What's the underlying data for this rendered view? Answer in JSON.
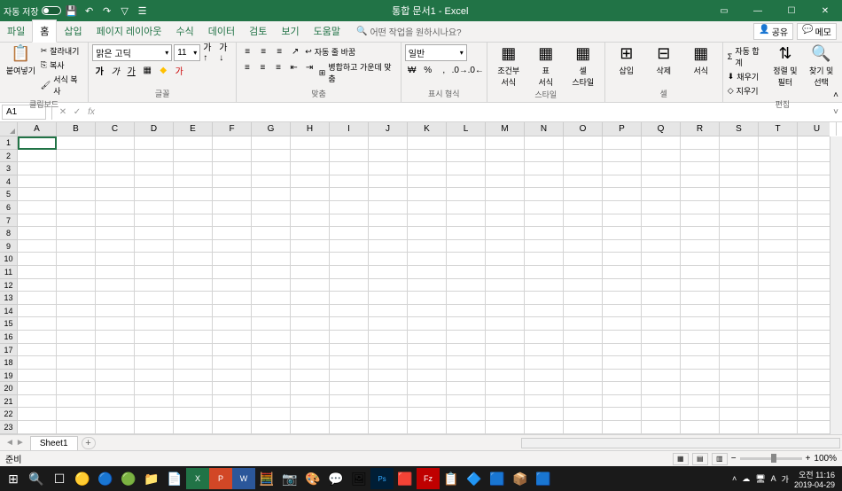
{
  "titlebar": {
    "auto_save": "자동 저장",
    "title": "통합 문서1 - Excel"
  },
  "tabs": {
    "file": "파일",
    "home": "홈",
    "insert": "삽입",
    "layout": "페이지 레이아웃",
    "formulas": "수식",
    "data": "데이터",
    "review": "검토",
    "view": "보기",
    "help": "도움말",
    "tell_me": "어떤 작업을 원하시나요?",
    "share": "공유",
    "memo": "메모"
  },
  "ribbon": {
    "clipboard": {
      "paste": "붙여넣기",
      "cut": "잘라내기",
      "copy": "복사",
      "format_painter": "서식 복사",
      "label": "클립보드"
    },
    "font": {
      "name": "맑은 고딕",
      "size": "11",
      "label": "글꼴"
    },
    "alignment": {
      "wrap": "자동 줄 바꿈",
      "merge": "병합하고 가운데 맞춤",
      "label": "맞춤"
    },
    "number": {
      "format": "일반",
      "label": "표시 형식"
    },
    "styles": {
      "conditional": "조건부\n서식",
      "table": "표\n서식",
      "cell": "셀\n스타일",
      "label": "스타일"
    },
    "cells": {
      "insert": "삽입",
      "delete": "삭제",
      "format": "서식",
      "label": "셀"
    },
    "editing": {
      "sum": "자동 합계",
      "fill": "채우기",
      "clear": "지우기",
      "sort": "정렬 및\n필터",
      "find": "찾기 및\n선택",
      "label": "편집"
    }
  },
  "formula_bar": {
    "name_box": "A1"
  },
  "columns": [
    "A",
    "B",
    "C",
    "D",
    "E",
    "F",
    "G",
    "H",
    "I",
    "J",
    "K",
    "L",
    "M",
    "N",
    "O",
    "P",
    "Q",
    "R",
    "S",
    "T",
    "U"
  ],
  "rows": [
    "1",
    "2",
    "3",
    "4",
    "5",
    "6",
    "7",
    "8",
    "9",
    "10",
    "11",
    "12",
    "13",
    "14",
    "15",
    "16",
    "17",
    "18",
    "19",
    "20",
    "21",
    "22",
    "23"
  ],
  "sheet": {
    "name": "Sheet1"
  },
  "status": {
    "ready": "준비",
    "zoom": "100%"
  },
  "taskbar": {
    "time": "오전 11:16",
    "date": "2019-04-29"
  }
}
